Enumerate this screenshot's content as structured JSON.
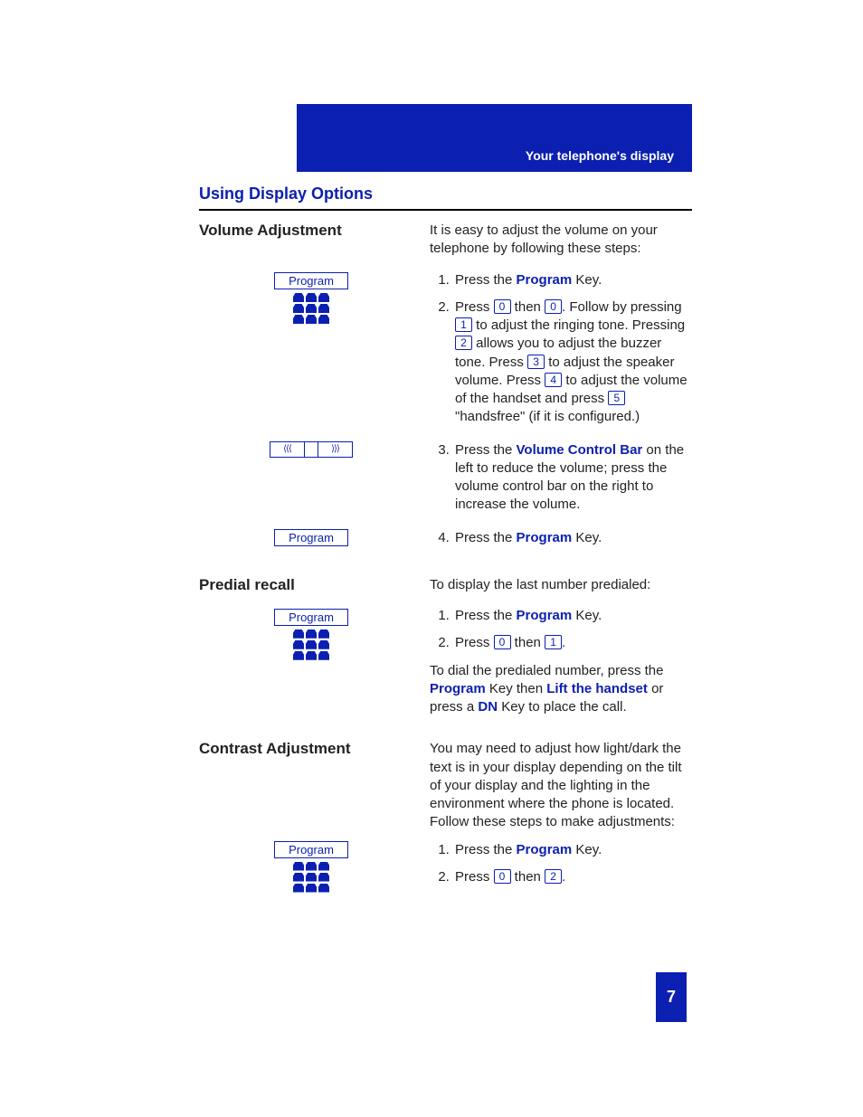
{
  "header": {
    "label": "Your telephone's display"
  },
  "title": "Using Display Options",
  "program_label": "Program",
  "page_number": "7",
  "sections": {
    "volume": {
      "heading": "Volume Adjustment",
      "intro": "It is easy to adjust the volume on your telephone by following these steps:",
      "step1_a": "Press the ",
      "step1_b": "Program",
      "step1_c": " Key.",
      "step2_a": "Press ",
      "step2_key1": "0",
      "step2_b": " then ",
      "step2_key2": "0",
      "step2_c": ". Follow by pressing ",
      "step2_key3": "1",
      "step2_d": " to adjust the ringing tone. Pressing ",
      "step2_key4": "2",
      "step2_e": " allows you to adjust the buzzer tone.  Press ",
      "step2_key5": "3",
      "step2_f": " to adjust the speaker volume.  Press ",
      "step2_key6": "4",
      "step2_g": " to adjust the volume of the handset and press ",
      "step2_key7": "5",
      "step2_h": " \"handsfree\" (if it is configured.)",
      "step3_a": "Press the ",
      "step3_b": "Volume Control Bar",
      "step3_c": " on the left to reduce the volume; press the volume control bar on the right to increase the volume.",
      "step4_a": "Press the ",
      "step4_b": "Program",
      "step4_c": " Key."
    },
    "predial": {
      "heading": "Predial recall",
      "intro": "To display the last number predialed:",
      "step1_a": "Press the ",
      "step1_b": "Program",
      "step1_c": " Key.",
      "step2_a": "Press ",
      "step2_key1": "0",
      "step2_b": " then ",
      "step2_key2": "1",
      "step2_c": ".",
      "outro_a": "To dial the predialed number, press the ",
      "outro_b": "Program",
      "outro_c": " Key then ",
      "outro_d": "Lift the handset",
      "outro_e": " or press a ",
      "outro_f": "DN",
      "outro_g": " Key to place the call."
    },
    "contrast": {
      "heading": "Contrast Adjustment",
      "intro": "You may need to adjust how light/dark the text is in your display depending on the tilt of your display and the lighting in the environment where the phone is located. Follow these steps to make adjustments:",
      "step1_a": "Press the ",
      "step1_b": "Program",
      "step1_c": " Key.",
      "step2_a": "Press ",
      "step2_key1": "0",
      "step2_b": " then ",
      "step2_key2": "2",
      "step2_c": "."
    }
  }
}
